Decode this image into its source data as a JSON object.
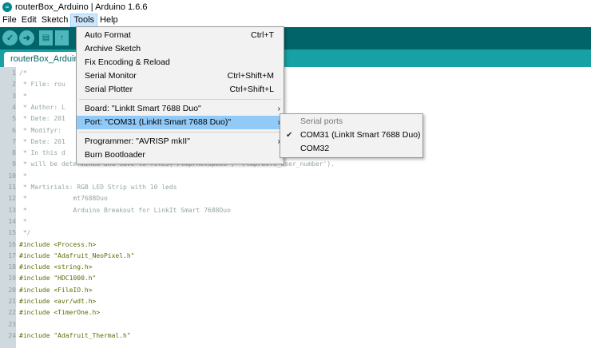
{
  "window": {
    "title": "routerBox_Arduino | Arduino 1.6.6",
    "logo_glyph": "∞"
  },
  "menubar": [
    "File",
    "Edit",
    "Sketch",
    "Tools",
    "Help"
  ],
  "toolbar": {
    "verify_icon": "✓",
    "upload_icon": "➜",
    "new_icon": "▤",
    "open_icon": "↑"
  },
  "tab": {
    "label": "routerBox_Arduino"
  },
  "tools_menu": {
    "auto_format": {
      "label": "Auto Format",
      "shortcut": "Ctrl+T"
    },
    "archive_sketch": {
      "label": "Archive Sketch"
    },
    "fix_encoding": {
      "label": "Fix Encoding & Reload"
    },
    "serial_monitor": {
      "label": "Serial Monitor",
      "shortcut": "Ctrl+Shift+M"
    },
    "serial_plotter": {
      "label": "Serial Plotter",
      "shortcut": "Ctrl+Shift+L"
    },
    "board": {
      "label": "Board: \"LinkIt Smart 7688 Duo\"",
      "arrow": "›"
    },
    "port": {
      "label": "Port: \"COM31 (LinkIt Smart 7688 Duo)\"",
      "arrow": "›"
    },
    "programmer": {
      "label": "Programmer: \"AVRISP mkII\"",
      "arrow": "›"
    },
    "burn_bootloader": {
      "label": "Burn Bootloader"
    }
  },
  "port_submenu": {
    "header": "Serial ports",
    "check": "✔",
    "items": [
      {
        "label": "COM31 (LinkIt Smart 7688 Duo)",
        "selected": true
      },
      {
        "label": "COM32",
        "selected": false
      }
    ]
  },
  "code_lines": [
    {
      "num": "1",
      "text": "/*"
    },
    {
      "num": "2",
      "text": " * File: rou"
    },
    {
      "num": "3",
      "text": " *"
    },
    {
      "num": "4",
      "text": " * Author: L"
    },
    {
      "num": "5",
      "text": " * Date: 201"
    },
    {
      "num": "6",
      "text": " * Modifyr: "
    },
    {
      "num": "7",
      "text": " * Date: 201"
    },
    {
      "num": "8",
      "text": " * In this d"
    },
    {
      "num": "9",
      "text": " * will be determined and save to files('/tmp/netSpeed', '/tmp/wifi_user_number')."
    },
    {
      "num": "10",
      "text": " *"
    },
    {
      "num": "11",
      "text": " * Martirials: RGB LED Strip with 10 leds"
    },
    {
      "num": "12",
      "text": " *            mt7688Duo"
    },
    {
      "num": "13",
      "text": " *            Arduino Breakout for LinkIt Smart 7688Duo"
    },
    {
      "num": "14",
      "text": " *"
    },
    {
      "num": "15",
      "text": " */"
    },
    {
      "num": "16",
      "text": "#include <Process.h>"
    },
    {
      "num": "17",
      "text": "#include \"Adafruit_NeoPixel.h\""
    },
    {
      "num": "18",
      "text": "#include <string.h>"
    },
    {
      "num": "19",
      "text": "#include \"HDC1000.h\""
    },
    {
      "num": "20",
      "text": "#include <FileIO.h>"
    },
    {
      "num": "21",
      "text": "#include <avr/wdt.h>"
    },
    {
      "num": "22",
      "text": "#include <TimerOne.h>"
    },
    {
      "num": "23",
      "text": ""
    },
    {
      "num": "24",
      "text": "#include \"Adafruit_Thermal.h\""
    }
  ],
  "colors": {
    "toolbar": "#006468",
    "tabstrip": "#17a1a5",
    "menu_highlight": "#91c9f7",
    "gutter": "#d0d9dd"
  }
}
